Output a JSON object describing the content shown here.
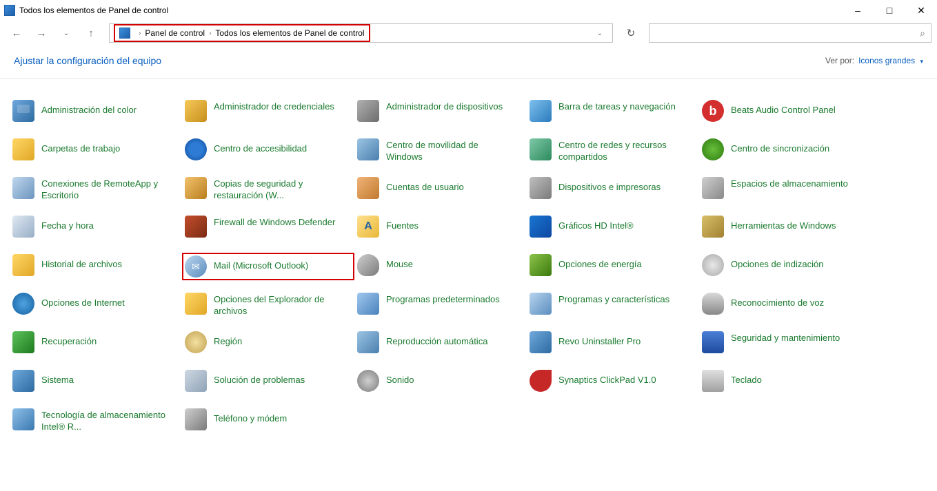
{
  "window": {
    "title": "Todos los elementos de Panel de control"
  },
  "addressbar": {
    "crumb1": "Panel de control",
    "crumb2": "Todos los elementos de Panel de control"
  },
  "search": {
    "placeholder": ""
  },
  "subheader": {
    "heading": "Ajustar la configuración del equipo",
    "viewby_label": "Ver por:",
    "viewby_value": "Iconos grandes"
  },
  "items": [
    {
      "label": "Administración del color",
      "icon": "ic-monitor",
      "single": true
    },
    {
      "label": "Administrador de credenciales",
      "icon": "ic-key"
    },
    {
      "label": "Administrador de dispositivos",
      "icon": "ic-device"
    },
    {
      "label": "Barra de tareas y navegación",
      "icon": "ic-taskbar"
    },
    {
      "label": "Beats Audio Control Panel",
      "icon": "ic-beats",
      "single": true
    },
    {
      "label": "Carpetas de trabajo",
      "icon": "ic-folder",
      "single": true
    },
    {
      "label": "Centro de accesibilidad",
      "icon": "ic-access",
      "single": true
    },
    {
      "label": "Centro de movilidad de Windows",
      "icon": "ic-mobility"
    },
    {
      "label": "Centro de redes y recursos compartidos",
      "icon": "ic-network"
    },
    {
      "label": "Centro de sincronización",
      "icon": "ic-sync",
      "single": true
    },
    {
      "label": "Conexiones de RemoteApp y Escritorio",
      "icon": "ic-remote"
    },
    {
      "label": "Copias de seguridad y restauración (W...",
      "icon": "ic-backup"
    },
    {
      "label": "Cuentas de usuario",
      "icon": "ic-users",
      "single": true
    },
    {
      "label": "Dispositivos e impresoras",
      "icon": "ic-printer",
      "single": true
    },
    {
      "label": "Espacios de almacenamiento",
      "icon": "ic-storage"
    },
    {
      "label": "Fecha y hora",
      "icon": "ic-date",
      "single": true
    },
    {
      "label": "Firewall de Windows Defender",
      "icon": "ic-firewall"
    },
    {
      "label": "Fuentes",
      "icon": "ic-fonts",
      "single": true
    },
    {
      "label": "Gráficos HD Intel®",
      "icon": "ic-intel",
      "single": true
    },
    {
      "label": "Herramientas de Windows",
      "icon": "ic-tools",
      "single": true
    },
    {
      "label": "Historial de archivos",
      "icon": "ic-history",
      "single": true
    },
    {
      "label": "Mail (Microsoft Outlook)",
      "icon": "ic-mail",
      "single": true,
      "highlight": true
    },
    {
      "label": "Mouse",
      "icon": "ic-mouse",
      "single": true
    },
    {
      "label": "Opciones de energía",
      "icon": "ic-power",
      "single": true
    },
    {
      "label": "Opciones de indización",
      "icon": "ic-index",
      "single": true
    },
    {
      "label": "Opciones de Internet",
      "icon": "ic-internet",
      "single": true
    },
    {
      "label": "Opciones del Explorador de archivos",
      "icon": "ic-folderopt"
    },
    {
      "label": "Programas predeterminados",
      "icon": "ic-defaults"
    },
    {
      "label": "Programas y características",
      "icon": "ic-programs"
    },
    {
      "label": "Reconocimiento de voz",
      "icon": "ic-speech",
      "single": true
    },
    {
      "label": "Recuperación",
      "icon": "ic-recovery",
      "single": true
    },
    {
      "label": "Región",
      "icon": "ic-region",
      "single": true
    },
    {
      "label": "Reproducción automática",
      "icon": "ic-autoplay",
      "single": true
    },
    {
      "label": "Revo Uninstaller Pro",
      "icon": "ic-revo",
      "single": true
    },
    {
      "label": "Seguridad y mantenimiento",
      "icon": "ic-security"
    },
    {
      "label": "Sistema",
      "icon": "ic-system",
      "single": true
    },
    {
      "label": "Solución de problemas",
      "icon": "ic-trouble",
      "single": true
    },
    {
      "label": "Sonido",
      "icon": "ic-sound",
      "single": true
    },
    {
      "label": "Synaptics ClickPad V1.0",
      "icon": "ic-synaptics",
      "single": true
    },
    {
      "label": "Teclado",
      "icon": "ic-keyboard",
      "single": true
    },
    {
      "label": "Tecnología de almacenamiento Intel® R...",
      "icon": "ic-inteltech"
    },
    {
      "label": "Teléfono y módem",
      "icon": "ic-phone",
      "single": true
    }
  ]
}
